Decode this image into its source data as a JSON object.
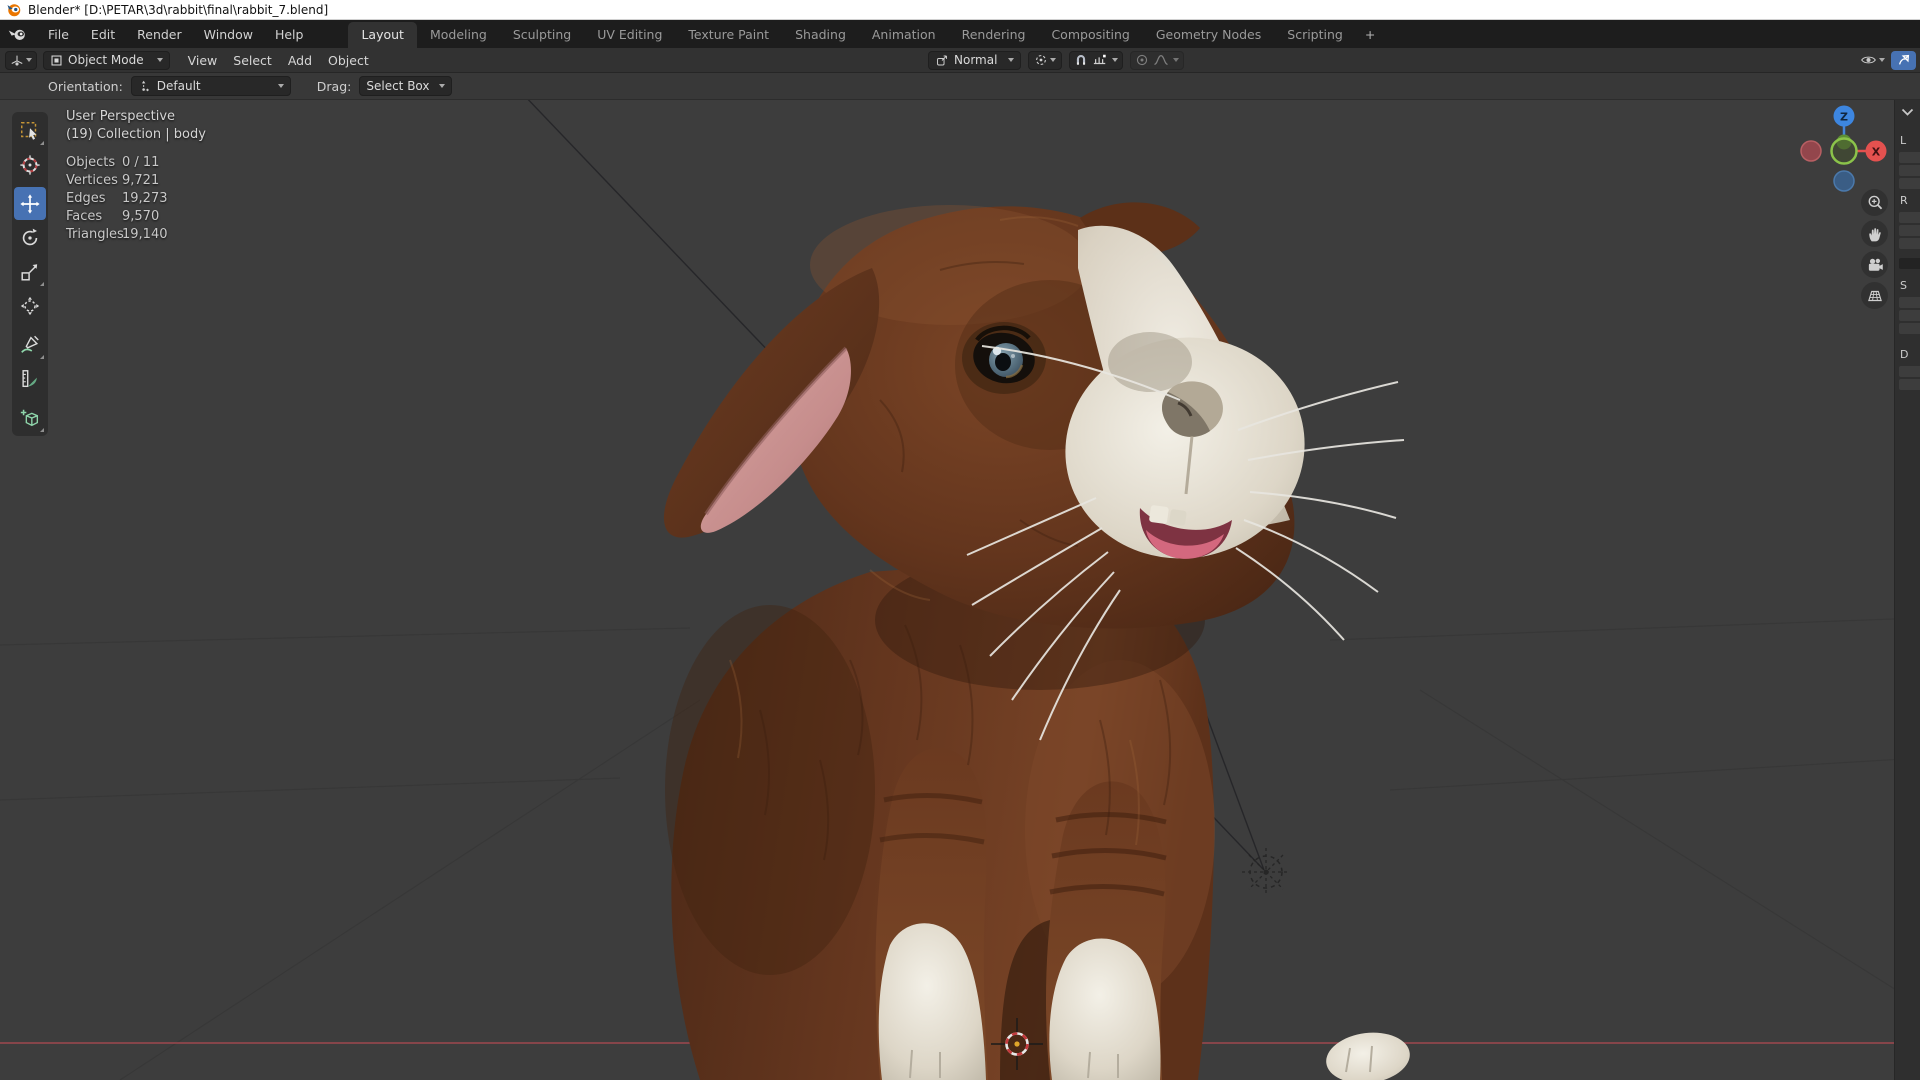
{
  "titlebar": {
    "title": "Blender* [D:\\PETAR\\3d\\rabbit\\final\\rabbit_7.blend]"
  },
  "menubar": {
    "menus": [
      {
        "label": "File"
      },
      {
        "label": "Edit"
      },
      {
        "label": "Render"
      },
      {
        "label": "Window"
      },
      {
        "label": "Help"
      }
    ],
    "workspaces": [
      {
        "label": "Layout",
        "active": true
      },
      {
        "label": "Modeling"
      },
      {
        "label": "Sculpting"
      },
      {
        "label": "UV Editing"
      },
      {
        "label": "Texture Paint"
      },
      {
        "label": "Shading"
      },
      {
        "label": "Animation"
      },
      {
        "label": "Rendering"
      },
      {
        "label": "Compositing"
      },
      {
        "label": "Geometry Nodes"
      },
      {
        "label": "Scripting"
      },
      {
        "label": "+"
      }
    ]
  },
  "viewport_header": {
    "mode": "Object Mode",
    "menus": [
      {
        "label": "View"
      },
      {
        "label": "Select"
      },
      {
        "label": "Add"
      },
      {
        "label": "Object"
      }
    ],
    "transform_orientation": "Normal",
    "icons": [
      "editor-type-icon",
      "mode-icon",
      "orientation-icon",
      "pivot-icon",
      "magnet-icon",
      "snap-with-icon",
      "proportional-icon",
      "falloff-icon",
      "visibility-eye-icon",
      "show-gizmo-icon"
    ]
  },
  "tool_settings": {
    "orientation_label": "Orientation:",
    "orientation_value": "Default",
    "drag_label": "Drag:",
    "drag_value": "Select Box"
  },
  "toolbar": {
    "tools": [
      "select-box",
      "cursor",
      "move",
      "rotate",
      "scale",
      "transform",
      "annotate",
      "measure",
      "add-cube"
    ],
    "active_tool": "move"
  },
  "overlay": {
    "view_name": "User Perspective",
    "collection": "(19) Collection | body",
    "stats": [
      {
        "label": "Objects",
        "value": "0 / 11"
      },
      {
        "label": "Vertices",
        "value": "9,721"
      },
      {
        "label": "Edges",
        "value": "19,273"
      },
      {
        "label": "Faces",
        "value": "9,570"
      },
      {
        "label": "Triangles",
        "value": "19,140"
      }
    ]
  },
  "gizmo": {
    "axis_z": "Z",
    "axis_x": "X"
  },
  "nav_buttons": [
    "zoom",
    "pan",
    "camera-view",
    "toggle-ortho"
  ],
  "sidebar_edge": {
    "panel_labels": [
      "L",
      "R",
      "S",
      "D"
    ]
  },
  "colors": {
    "accent_blue": "#4772b3",
    "axis_x_red": "#aa4a50",
    "axis_y_green": "#6f9a47",
    "header_bg": "#323232",
    "viewport_bg": "#3d3d3d",
    "titlebar_bg": "#ffffff"
  }
}
